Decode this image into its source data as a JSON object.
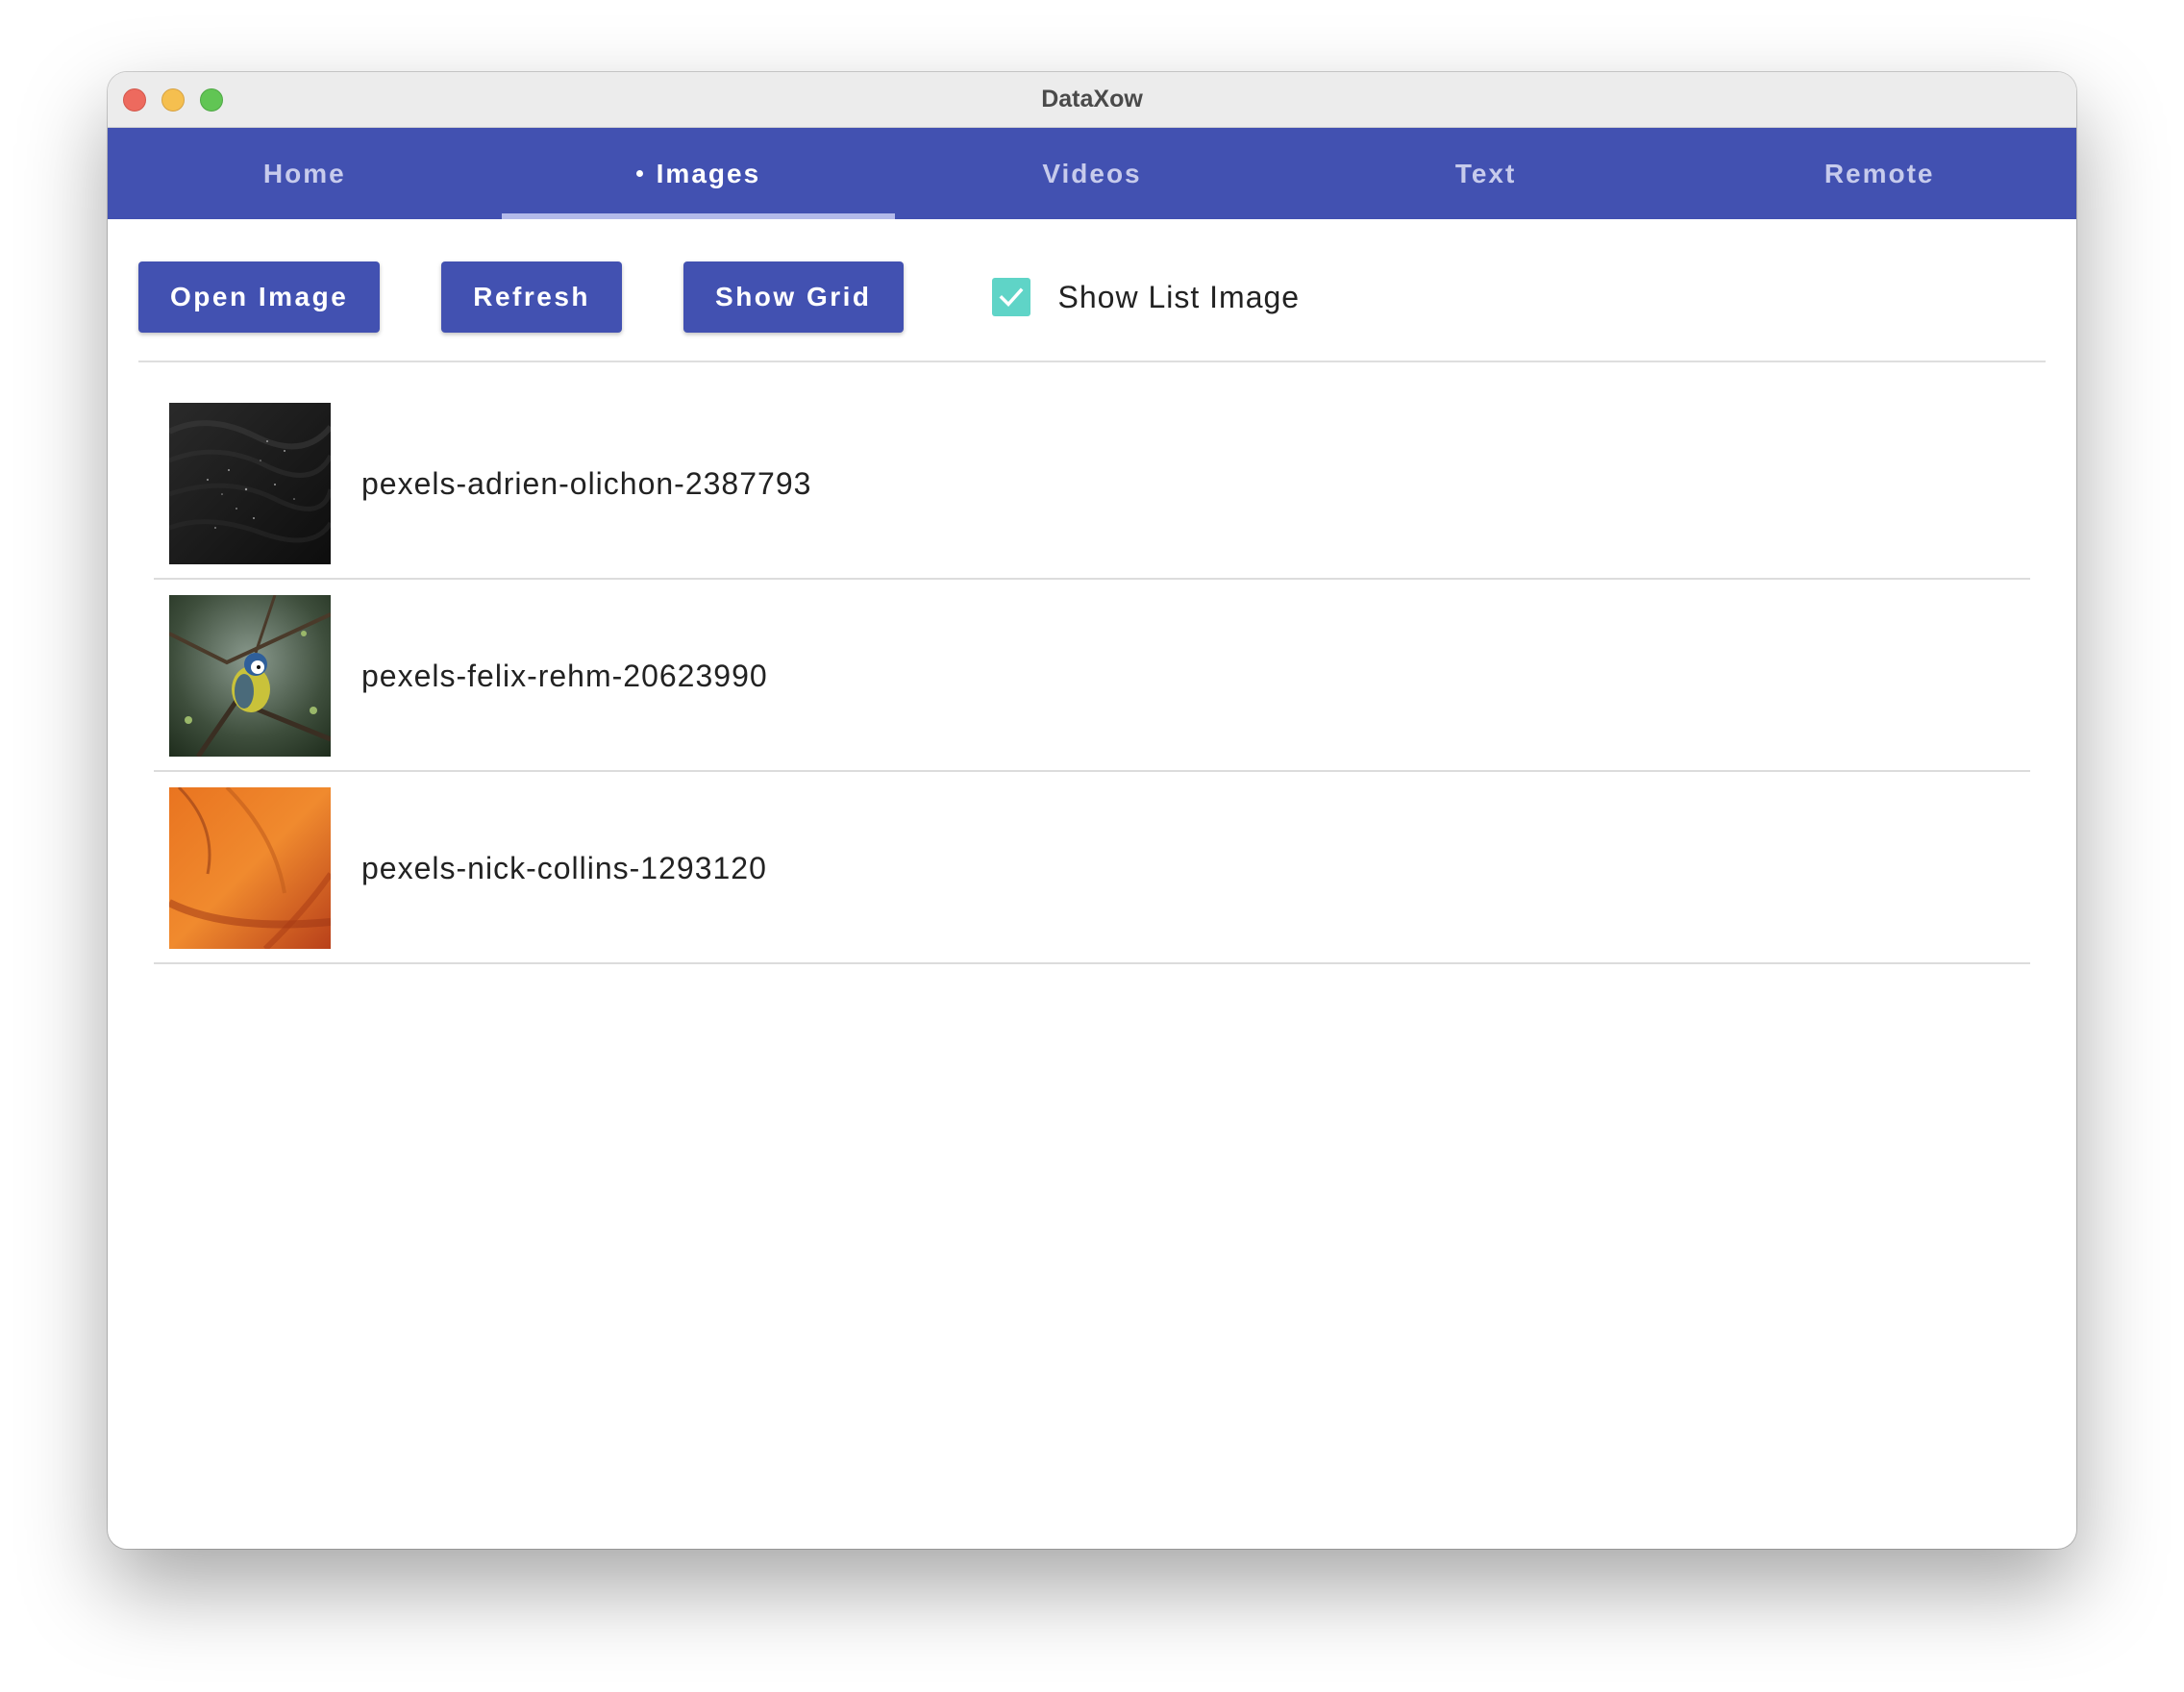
{
  "window": {
    "title": "DataXow"
  },
  "tabs": [
    {
      "label": "Home",
      "active": false
    },
    {
      "label": "Images",
      "active": true
    },
    {
      "label": "Videos",
      "active": false
    },
    {
      "label": "Text",
      "active": false
    },
    {
      "label": "Remote",
      "active": false
    }
  ],
  "toolbar": {
    "open_image_label": "Open Image",
    "refresh_label": "Refresh",
    "show_grid_label": "Show Grid",
    "show_list_image": {
      "label": "Show List Image",
      "checked": true
    }
  },
  "images": [
    {
      "name": "pexels-adrien-olichon-2387793",
      "thumbnail": "dark sand texture"
    },
    {
      "name": "pexels-felix-rehm-20623990",
      "thumbnail": "blue tit bird on branch"
    },
    {
      "name": "pexels-nick-collins-1293120",
      "thumbnail": "orange texture"
    }
  ],
  "colors": {
    "accent": "#4251b1",
    "tab_indicator": "#b3baea",
    "checkbox": "#5fd4c7"
  }
}
